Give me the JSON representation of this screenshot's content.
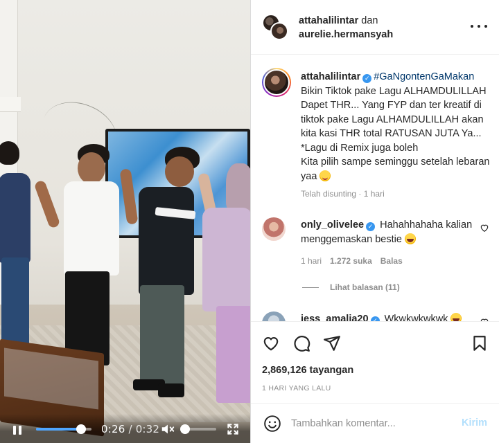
{
  "video": {
    "current_time": "0:26",
    "separator": "/",
    "duration": "0:32",
    "progress": 0.81,
    "volume": 0.1,
    "controls": {
      "pause_icon": "pause-icon",
      "mute_icon": "speaker-muted-icon",
      "fullscreen_icon": "fullscreen-icon"
    },
    "accent_color": "#4fa6ff"
  },
  "header": {
    "user1": "attahalilintar",
    "conjunction": "dan",
    "user2": "aurelie.hermansyah",
    "more_icon": "more-options-icon"
  },
  "caption": {
    "username": "attahalilintar",
    "hashtag": "#GaNgontenGaMakan",
    "body": "Bikin Tiktok pake Lagu ALHAMDULILLAH Dapet THR... Yang FYP dan ter kreatif di tiktok pake Lagu ALHAMDULILLAH akan kita kasi THR total RATUSAN JUTA Ya...\n*Lagu di Remix juga boleh\nKita pilih sampe seminggu setelah lebaran yaa",
    "meta": "Telah disunting · 1 hari"
  },
  "comments": [
    {
      "username": "only_olivelee",
      "text": "Hahahhahaha kalian menggemaskan bestie",
      "time": "1 hari",
      "likes": "1.272 suka",
      "reply_label": "Balas",
      "view_replies": "Lihat balasan (11)"
    },
    {
      "username": "jess_amalia20",
      "text": "Wkwkwkwkwk"
    }
  ],
  "actions": {
    "like_icon": "heart-icon",
    "comment_icon": "comment-icon",
    "share_icon": "send-icon",
    "save_icon": "bookmark-icon",
    "views": "2,869,126 tayangan",
    "posted": "1 HARI YANG LALU"
  },
  "comment_box": {
    "placeholder": "Tambahkan komentar...",
    "post_label": "Kirim",
    "emoji_icon": "smile-icon"
  },
  "colors": {
    "link": "#00376b",
    "verified": "#3897f0",
    "muted": "#8e8e8e",
    "post_disabled": "#b2dffc"
  }
}
